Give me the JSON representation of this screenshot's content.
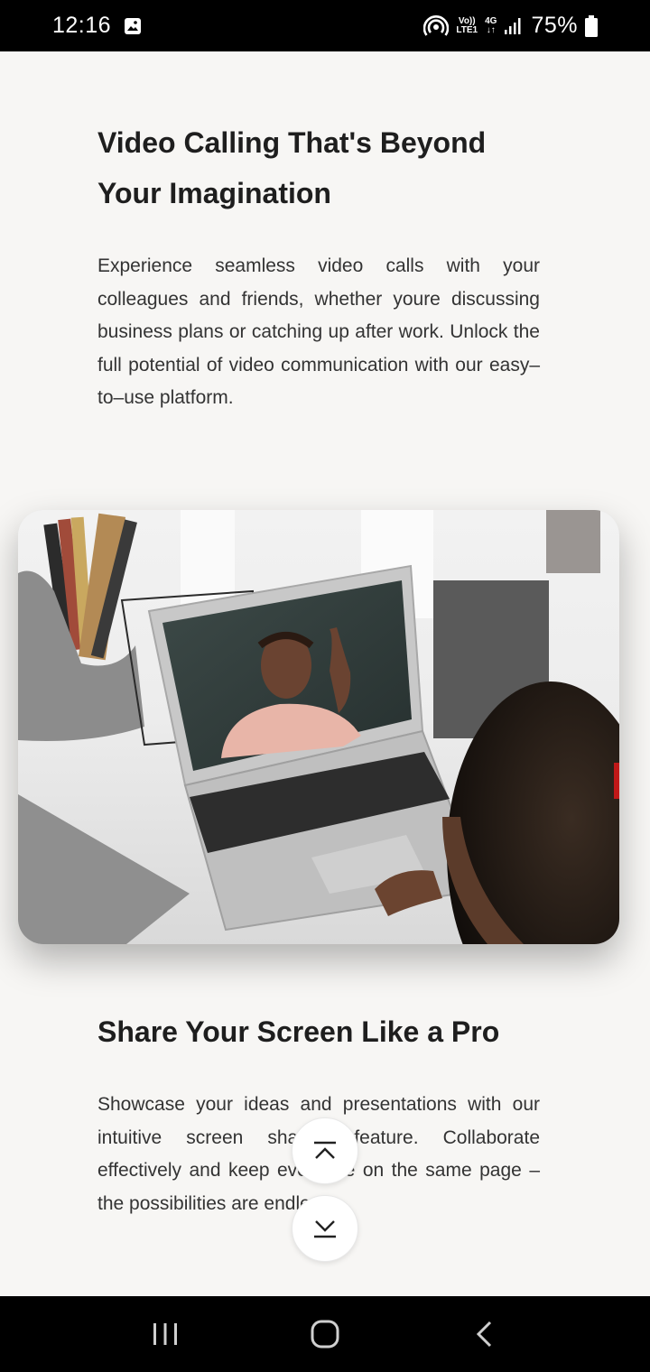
{
  "status_bar": {
    "time": "12:16",
    "network_top": "Vo))",
    "network_bottom": "LTE1",
    "data_top": "4G",
    "data_bottom": "↓↑",
    "battery": "75%",
    "icons": [
      "gallery-icon",
      "hotspot-icon",
      "signal-icon",
      "battery-icon"
    ]
  },
  "sections": [
    {
      "title_line1": "Video Calling That's Beyond",
      "title_line2": "Your Imagination",
      "body": "Experience seamless video calls with your colleagues and friends, whether youre discussing business plans or catching up after work. Unlock the full potential of video communication with our easy–to–use platform."
    },
    {
      "title": "Share Your Screen Like a Pro",
      "body": "Showcase your ideas and presentations with our intuitive screen sharing feature. Collaborate effectively and keep everyone on the same page – the possibilities are endless!"
    }
  ],
  "scroll_buttons": {
    "up_icon": "chevron-up-to-top-icon",
    "down_icon": "chevron-down-to-bottom-icon"
  },
  "nav_bar": {
    "icons": [
      "recent-apps-icon",
      "home-icon",
      "back-icon"
    ]
  },
  "colors": {
    "background": "#f7f6f4",
    "text": "#1e1e1e",
    "bars": "#000000"
  }
}
